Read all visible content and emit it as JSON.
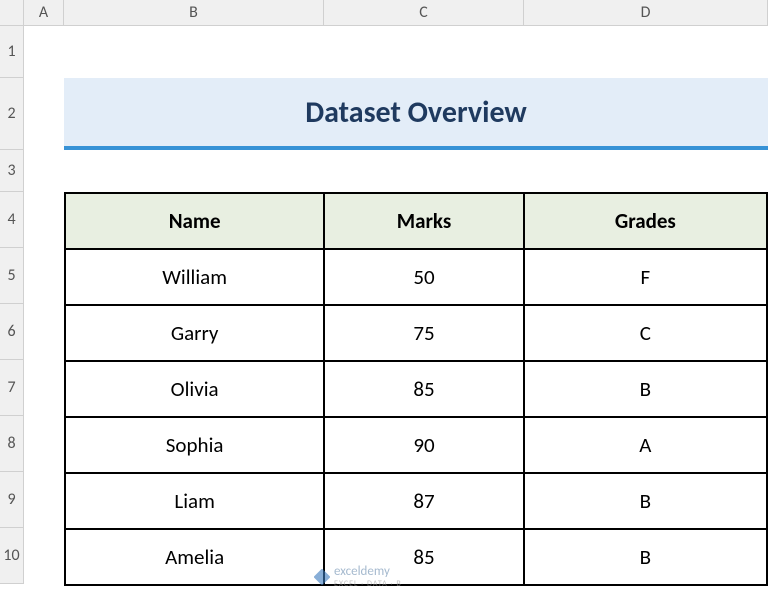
{
  "columns": {
    "A": "A",
    "B": "B",
    "C": "C",
    "D": "D"
  },
  "rows": {
    "r1": "1",
    "r2": "2",
    "r3": "3",
    "r4": "4",
    "r5": "5",
    "r6": "6",
    "r7": "7",
    "r8": "8",
    "r9": "9",
    "r10": "10"
  },
  "title": "Dataset Overview",
  "headers": {
    "name": "Name",
    "marks": "Marks",
    "grades": "Grades"
  },
  "data": [
    {
      "name": "William",
      "marks": "50",
      "grades": "F"
    },
    {
      "name": "Garry",
      "marks": "75",
      "grades": "C"
    },
    {
      "name": "Olivia",
      "marks": "85",
      "grades": "B"
    },
    {
      "name": "Sophia",
      "marks": "90",
      "grades": "A"
    },
    {
      "name": "Liam",
      "marks": "87",
      "grades": "B"
    },
    {
      "name": "Amelia",
      "marks": "85",
      "grades": "B"
    }
  ],
  "watermark": {
    "brand": "exceldemy",
    "sub": "EXCEL · DATA · B"
  },
  "chart_data": {
    "type": "table",
    "title": "Dataset Overview",
    "columns": [
      "Name",
      "Marks",
      "Grades"
    ],
    "rows": [
      [
        "William",
        50,
        "F"
      ],
      [
        "Garry",
        75,
        "C"
      ],
      [
        "Olivia",
        85,
        "B"
      ],
      [
        "Sophia",
        90,
        "A"
      ],
      [
        "Liam",
        87,
        "B"
      ],
      [
        "Amelia",
        85,
        "B"
      ]
    ]
  }
}
